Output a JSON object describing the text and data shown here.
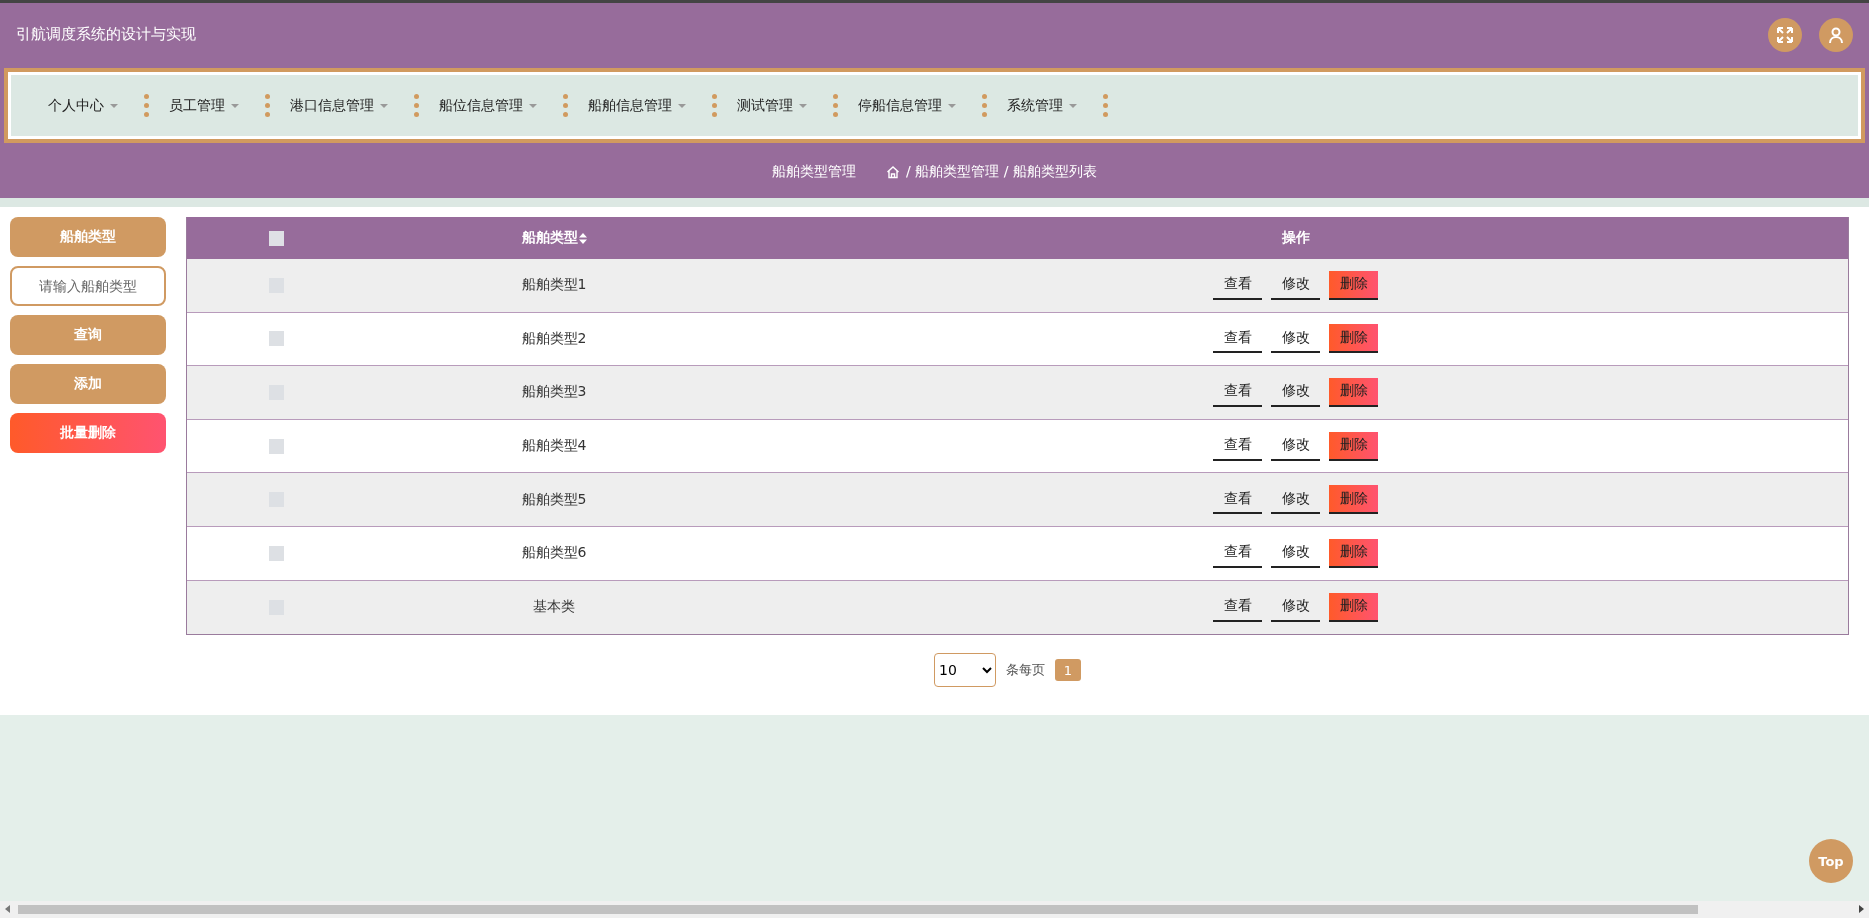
{
  "header": {
    "title": "引航调度系统的设计与实现"
  },
  "nav": [
    {
      "label": "个人中心"
    },
    {
      "label": "员工管理"
    },
    {
      "label": "港口信息管理"
    },
    {
      "label": "船位信息管理"
    },
    {
      "label": "船舶信息管理"
    },
    {
      "label": "测试管理"
    },
    {
      "label": "停船信息管理"
    },
    {
      "label": "系统管理"
    }
  ],
  "breadcrumb": {
    "title": "船舶类型管理",
    "trail": "/ 船舶类型管理 / 船舶类型列表"
  },
  "sidebar": {
    "label": "船舶类型",
    "search": {
      "placeholder": "请输入船舶类型"
    },
    "buttons": [
      {
        "label": "查询",
        "kind": "primary"
      },
      {
        "label": "添加",
        "kind": "primary"
      },
      {
        "label": "批量删除",
        "kind": "danger"
      }
    ]
  },
  "table": {
    "header_checked": false,
    "columns": [
      "船舶类型",
      "操作"
    ],
    "rows": [
      {
        "checked": false,
        "name": "船舶类型1",
        "actions": [
          {
            "label": "查看",
            "kind": "plain"
          },
          {
            "label": "修改",
            "kind": "plain"
          },
          {
            "label": "删除",
            "kind": "danger"
          }
        ]
      },
      {
        "checked": false,
        "name": "船舶类型2",
        "actions": [
          {
            "label": "查看",
            "kind": "plain"
          },
          {
            "label": "修改",
            "kind": "plain"
          },
          {
            "label": "删除",
            "kind": "danger"
          }
        ]
      },
      {
        "checked": false,
        "name": "船舶类型3",
        "actions": [
          {
            "label": "查看",
            "kind": "plain"
          },
          {
            "label": "修改",
            "kind": "plain"
          },
          {
            "label": "删除",
            "kind": "danger"
          }
        ]
      },
      {
        "checked": false,
        "name": "船舶类型4",
        "actions": [
          {
            "label": "查看",
            "kind": "plain"
          },
          {
            "label": "修改",
            "kind": "plain"
          },
          {
            "label": "删除",
            "kind": "danger"
          }
        ]
      },
      {
        "checked": false,
        "name": "船舶类型5",
        "actions": [
          {
            "label": "查看",
            "kind": "plain"
          },
          {
            "label": "修改",
            "kind": "plain"
          },
          {
            "label": "删除",
            "kind": "danger"
          }
        ]
      },
      {
        "checked": false,
        "name": "船舶类型6",
        "actions": [
          {
            "label": "查看",
            "kind": "plain"
          },
          {
            "label": "修改",
            "kind": "plain"
          },
          {
            "label": "删除",
            "kind": "danger"
          }
        ]
      },
      {
        "checked": false,
        "name": "基本类",
        "actions": [
          {
            "label": "查看",
            "kind": "plain"
          },
          {
            "label": "修改",
            "kind": "plain"
          },
          {
            "label": "删除",
            "kind": "danger"
          }
        ]
      }
    ]
  },
  "pagination": {
    "page_size": "10",
    "page_size_label": "条每页",
    "pages": [
      {
        "label": "1",
        "selected": true
      }
    ]
  },
  "top_button": "Top"
}
